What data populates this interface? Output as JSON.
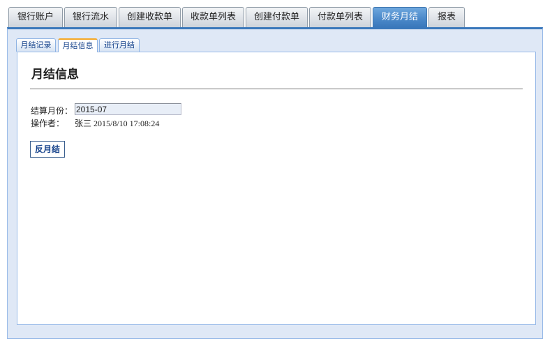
{
  "top_tabs": [
    {
      "label": "银行账户",
      "active": false
    },
    {
      "label": "银行流水",
      "active": false
    },
    {
      "label": "创建收款单",
      "active": false
    },
    {
      "label": "收款单列表",
      "active": false
    },
    {
      "label": "创建付款单",
      "active": false
    },
    {
      "label": "付款单列表",
      "active": false
    },
    {
      "label": "财务月结",
      "active": true
    },
    {
      "label": "报表",
      "active": false
    }
  ],
  "sub_tabs": [
    {
      "label": "月结记录",
      "active": false
    },
    {
      "label": "月结信息",
      "active": true
    },
    {
      "label": "进行月结",
      "active": false
    }
  ],
  "panel": {
    "title": "月结信息",
    "month_label": "结算月份：",
    "month_value": "2015-07",
    "operator_label": "操作者：",
    "operator_value": "张三 2015/8/10 17:08:24",
    "unclose_button": "反月结"
  },
  "colors": {
    "accent": "#3a78bb",
    "frame_background": "#dfe8f6",
    "active_subtab_top": "#f5a623"
  }
}
